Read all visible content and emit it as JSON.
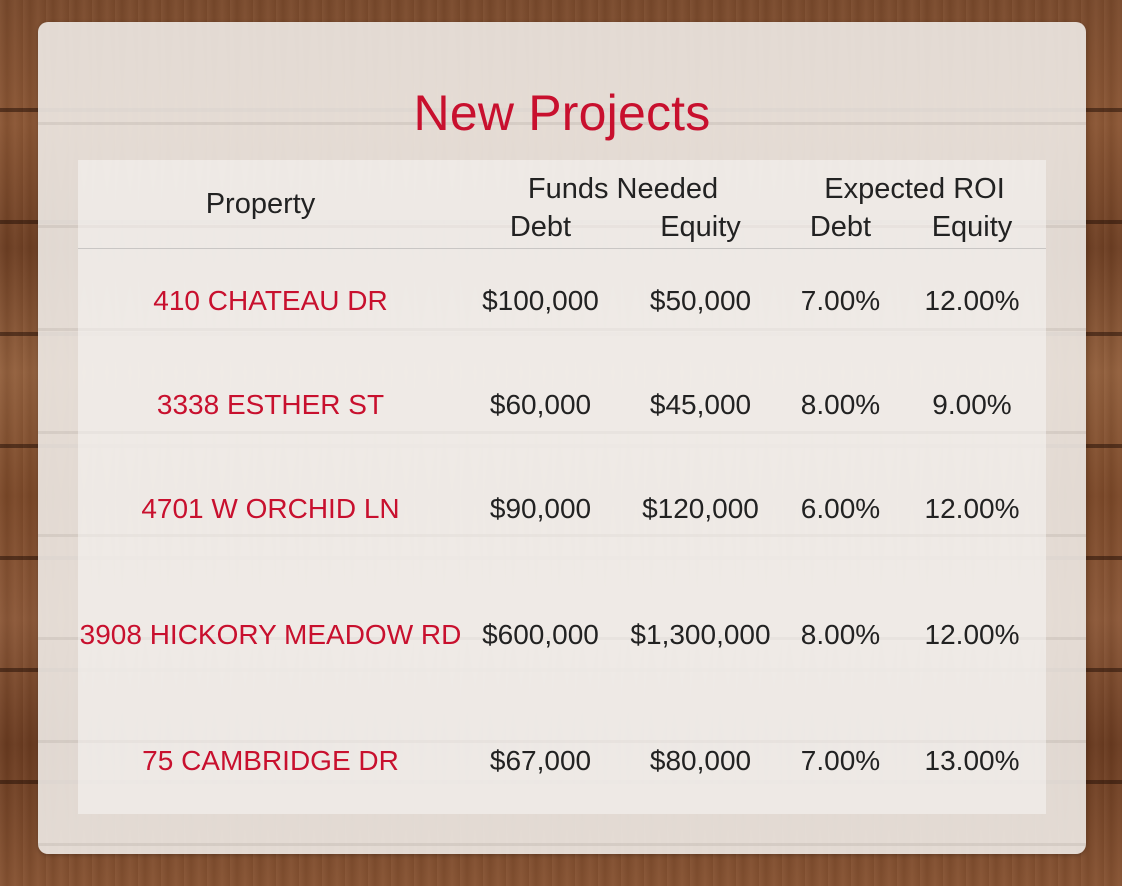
{
  "title": "New Projects",
  "table": {
    "headers": {
      "property": "Property",
      "funds_needed": "Funds Needed",
      "expected_roi": "Expected ROI",
      "debt": "Debt",
      "equity": "Equity"
    },
    "rows": [
      {
        "property": "410 CHATEAU DR",
        "funds_debt": "$100,000",
        "funds_equity": "$50,000",
        "roi_debt": "7.00%",
        "roi_equity": "12.00%"
      },
      {
        "property": "3338 ESTHER ST",
        "funds_debt": "$60,000",
        "funds_equity": "$45,000",
        "roi_debt": "8.00%",
        "roi_equity": "9.00%"
      },
      {
        "property": "4701 W ORCHID LN",
        "funds_debt": "$90,000",
        "funds_equity": "$120,000",
        "roi_debt": "6.00%",
        "roi_equity": "12.00%"
      },
      {
        "property": "3908 HICKORY MEADOW RD",
        "funds_debt": "$600,000",
        "funds_equity": "$1,300,000",
        "roi_debt": "8.00%",
        "roi_equity": "12.00%"
      },
      {
        "property": "75 CAMBRIDGE DR",
        "funds_debt": "$67,000",
        "funds_equity": "$80,000",
        "roi_debt": "7.00%",
        "roi_equity": "13.00%"
      }
    ]
  },
  "colors": {
    "accent": "#c8102e",
    "text": "#222222"
  }
}
